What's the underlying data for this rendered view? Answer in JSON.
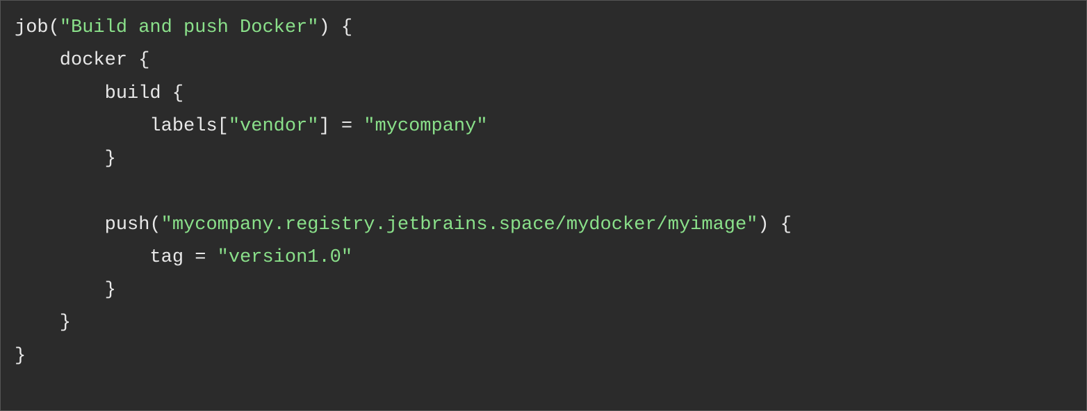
{
  "code": {
    "line1": {
      "t1": "job(",
      "s1": "\"Build and push Docker\"",
      "t2": ") {"
    },
    "line2": {
      "t1": "    docker {"
    },
    "line3": {
      "t1": "        build {"
    },
    "line4": {
      "t1": "            labels[",
      "s1": "\"vendor\"",
      "t2": "] = ",
      "s2": "\"mycompany\""
    },
    "line5": {
      "t1": "        }"
    },
    "line6": {
      "t1": ""
    },
    "line7": {
      "t1": "        push(",
      "s1": "\"mycompany.registry.jetbrains.space/mydocker/myimage\"",
      "t2": ") {"
    },
    "line8": {
      "t1": "            tag = ",
      "s1": "\"version1.0\""
    },
    "line9": {
      "t1": "        }"
    },
    "line10": {
      "t1": "    }"
    },
    "line11": {
      "t1": "}"
    }
  }
}
